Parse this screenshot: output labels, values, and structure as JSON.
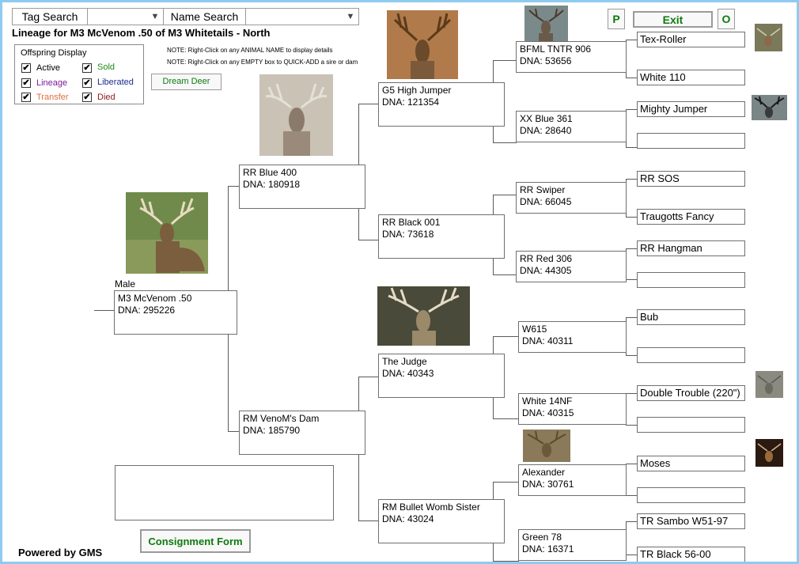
{
  "header": {
    "tag_search_label": "Tag Search",
    "name_search_label": "Name Search",
    "title": "Lineage for M3 McVenom .50 of M3 Whitetails - North",
    "note1": "NOTE: Right-Click on any ANIMAL NAME to display details",
    "note2": "NOTE: Right-Click on any EMPTY box to QUICK-ADD a sire or dam"
  },
  "buttons": {
    "p": "P",
    "exit": "Exit",
    "o": "O",
    "dream_deer": "Dream Deer",
    "consignment": "Consignment Form"
  },
  "offspring_display": {
    "title": "Offspring Display",
    "items": [
      {
        "label": "Active",
        "checked": true,
        "color": "#000000"
      },
      {
        "label": "Sold",
        "checked": true,
        "color": "#1a8a1a"
      },
      {
        "label": "Lineage",
        "checked": true,
        "color": "#7a1a9a"
      },
      {
        "label": "Liberated",
        "checked": true,
        "color": "#1a2a8a"
      },
      {
        "label": "Transfer",
        "checked": true,
        "color": "#e07040"
      },
      {
        "label": "Died",
        "checked": true,
        "color": "#8a1a1a"
      }
    ]
  },
  "check_mark": "✔",
  "subject": {
    "sex": "Male",
    "name": "M3 McVenom .50",
    "dna": "DNA: 295226"
  },
  "gen1": [
    {
      "name": "RR Blue 400",
      "dna": "DNA: 180918"
    },
    {
      "name": "RM VenoM's Dam",
      "dna": "DNA: 185790"
    }
  ],
  "gen2": [
    {
      "name": "G5 High Jumper",
      "dna": "DNA: 121354"
    },
    {
      "name": "RR Black 001",
      "dna": "DNA: 73618"
    },
    {
      "name": "The Judge",
      "dna": "DNA: 40343"
    },
    {
      "name": "RM Bullet Womb Sister",
      "dna": "DNA: 43024"
    }
  ],
  "gen3": [
    {
      "name": "BFML TNTR 906",
      "dna": "DNA: 53656"
    },
    {
      "name": "XX Blue 361",
      "dna": "DNA: 28640"
    },
    {
      "name": "RR Swiper",
      "dna": "DNA: 66045"
    },
    {
      "name": "RR Red 306",
      "dna": "DNA: 44305"
    },
    {
      "name": "W615",
      "dna": "DNA: 40311"
    },
    {
      "name": "White 14NF",
      "dna": "DNA: 40315"
    },
    {
      "name": "Alexander",
      "dna": "DNA: 30761"
    },
    {
      "name": "Green 78",
      "dna": "DNA: 16371"
    }
  ],
  "gen4": [
    "Tex-Roller",
    "White 110",
    "Mighty Jumper",
    "",
    "RR SOS",
    "Traugotts Fancy",
    "RR Hangman",
    "",
    "Bub",
    "",
    "Double Trouble (220\")",
    "",
    "Moses",
    "",
    "TR Sambo W51-97",
    "TR Black 56-00"
  ],
  "footer": {
    "powered_by": "Powered by GMS"
  }
}
